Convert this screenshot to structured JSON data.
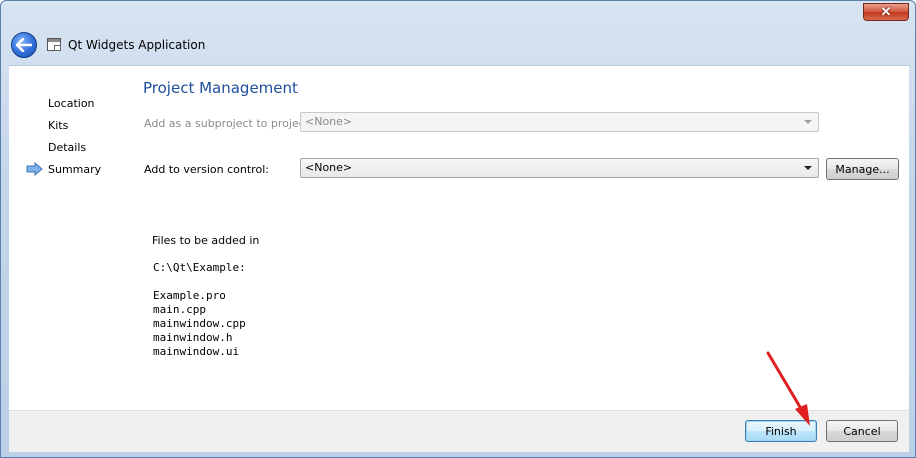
{
  "window": {
    "title": "Qt Widgets Application",
    "close_glyph": "✕"
  },
  "sidebar": {
    "items": [
      {
        "label": "Location",
        "current": false
      },
      {
        "label": "Kits",
        "current": false
      },
      {
        "label": "Details",
        "current": false
      },
      {
        "label": "Summary",
        "current": true
      }
    ]
  },
  "page": {
    "title": "Project Management",
    "subproject": {
      "label": "Add as a subproject to project:",
      "value": "<None>",
      "enabled": false
    },
    "version_control": {
      "label": "Add to version control:",
      "value": "<None>",
      "manage_label": "Manage..."
    },
    "files": {
      "heading": "Files to be added in",
      "directory": "C:\\Qt\\Example:",
      "list": [
        "Example.pro",
        "main.cpp",
        "mainwindow.cpp",
        "mainwindow.h",
        "mainwindow.ui"
      ]
    }
  },
  "footer": {
    "finish_label": "Finish",
    "cancel_label": "Cancel"
  },
  "icons": {
    "back": "back-arrow-icon",
    "title": "window-icon",
    "current_step": "arrow-right-icon",
    "annotation": "red-arrow-annotation"
  },
  "colors": {
    "accent_title": "#1f4e9c",
    "annotation": "#e02020",
    "close_button": "#c23a1e"
  }
}
